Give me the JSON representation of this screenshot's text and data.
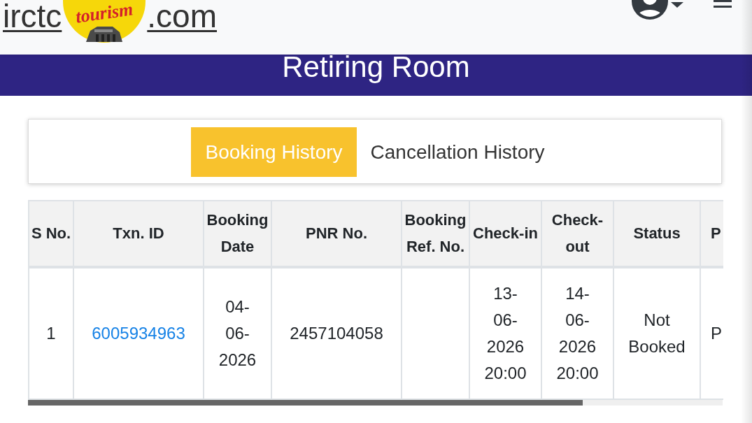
{
  "header": {
    "logo": {
      "text_left": "irctc",
      "emblem_text": "tourism",
      "text_right": ".com"
    }
  },
  "banner": {
    "title": "Retiring Room"
  },
  "tabs": [
    {
      "label": "Booking History",
      "selected": true
    },
    {
      "label": "Cancellation History",
      "selected": false
    }
  ],
  "table": {
    "columns": [
      "S No.",
      "Txn. ID",
      "Booking Date",
      "PNR No.",
      "Booking Ref. No.",
      "Check-in",
      "Check-out",
      "Status",
      "P"
    ],
    "rows": [
      {
        "cells": [
          {
            "kind": "text",
            "text": "1"
          },
          {
            "kind": "link",
            "text": "6005934963"
          },
          {
            "kind": "text",
            "text": "04-06-2026"
          },
          {
            "kind": "text",
            "text": "2457104058"
          },
          {
            "kind": "empty"
          },
          {
            "kind": "text",
            "text": "13-06-2026 20:00"
          },
          {
            "kind": "text",
            "text": "14-06-2026 20:00"
          },
          {
            "kind": "text",
            "text": "Not Booked"
          },
          {
            "kind": "text",
            "text": "P"
          }
        ]
      }
    ]
  }
}
